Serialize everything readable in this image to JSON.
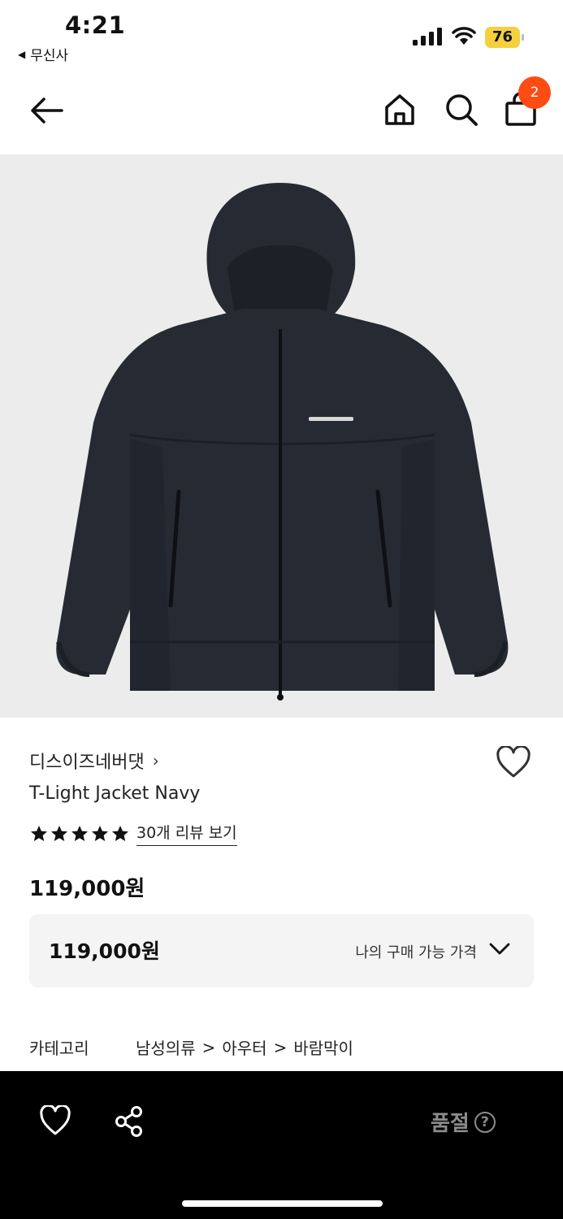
{
  "status_bar": {
    "time": "4:21",
    "back_app": "무신사",
    "battery": "76"
  },
  "header": {
    "cart_count": "2",
    "icons": [
      "back-arrow-icon",
      "home-icon",
      "search-icon",
      "shopping-bag-icon"
    ]
  },
  "product": {
    "brand": "디스이즈네버댓",
    "brand_chevron": "›",
    "name": "T-Light Jacket Navy",
    "rating_stars": 5,
    "review_link": "30개 리뷰 보기",
    "price": "119,000원",
    "my_price": "119,000원",
    "my_price_label": "나의 구매 가능 가격",
    "category_label": "카테고리",
    "category_path": [
      "남성의류",
      "아우터",
      "바람막이"
    ],
    "crumb_separator": ">"
  },
  "bottom_bar": {
    "status": "품절",
    "help_symbol": "?"
  },
  "colors": {
    "badge": "#ff4b14",
    "battery": "#f4d03f",
    "jacket": "#262b33"
  }
}
